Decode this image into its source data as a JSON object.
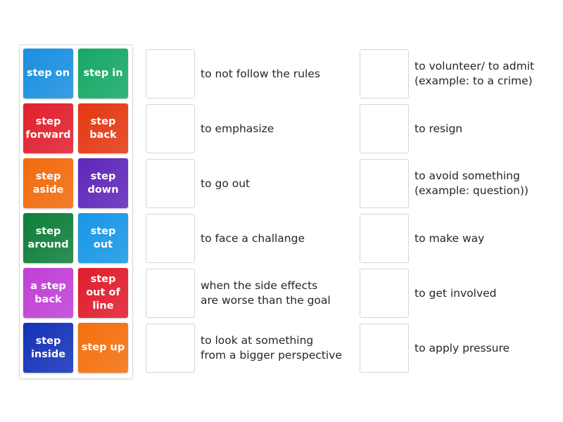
{
  "tiles": [
    {
      "label": "step on",
      "color": "#1a8fe0"
    },
    {
      "label": "step in",
      "color": "#16a866"
    },
    {
      "label": "step forward",
      "color": "#e0202e"
    },
    {
      "label": "step back",
      "color": "#e33812"
    },
    {
      "label": "step aside",
      "color": "#f26a0c"
    },
    {
      "label": "step down",
      "color": "#5e27b8"
    },
    {
      "label": "step around",
      "color": "#0e7e3a"
    },
    {
      "label": "step out",
      "color": "#1896e6"
    },
    {
      "label": "a step back",
      "color": "#c03fd6"
    },
    {
      "label": "step out of line",
      "color": "#e01c2c"
    },
    {
      "label": "step inside",
      "color": "#1432b8"
    },
    {
      "label": "step up",
      "color": "#f4700e"
    }
  ],
  "left_definitions": [
    "to not follow the rules",
    "to emphasize",
    "to go out",
    "to face a challange",
    "when the side effects\nare worse than the goal",
    "to look at something\nfrom a bigger perspective"
  ],
  "right_definitions": [
    "to volunteer/ to admit\n(example: to a crime)",
    "to resign",
    "to avoid something\n(example: question))",
    "to make way",
    "to get involved",
    "to apply pressure"
  ]
}
